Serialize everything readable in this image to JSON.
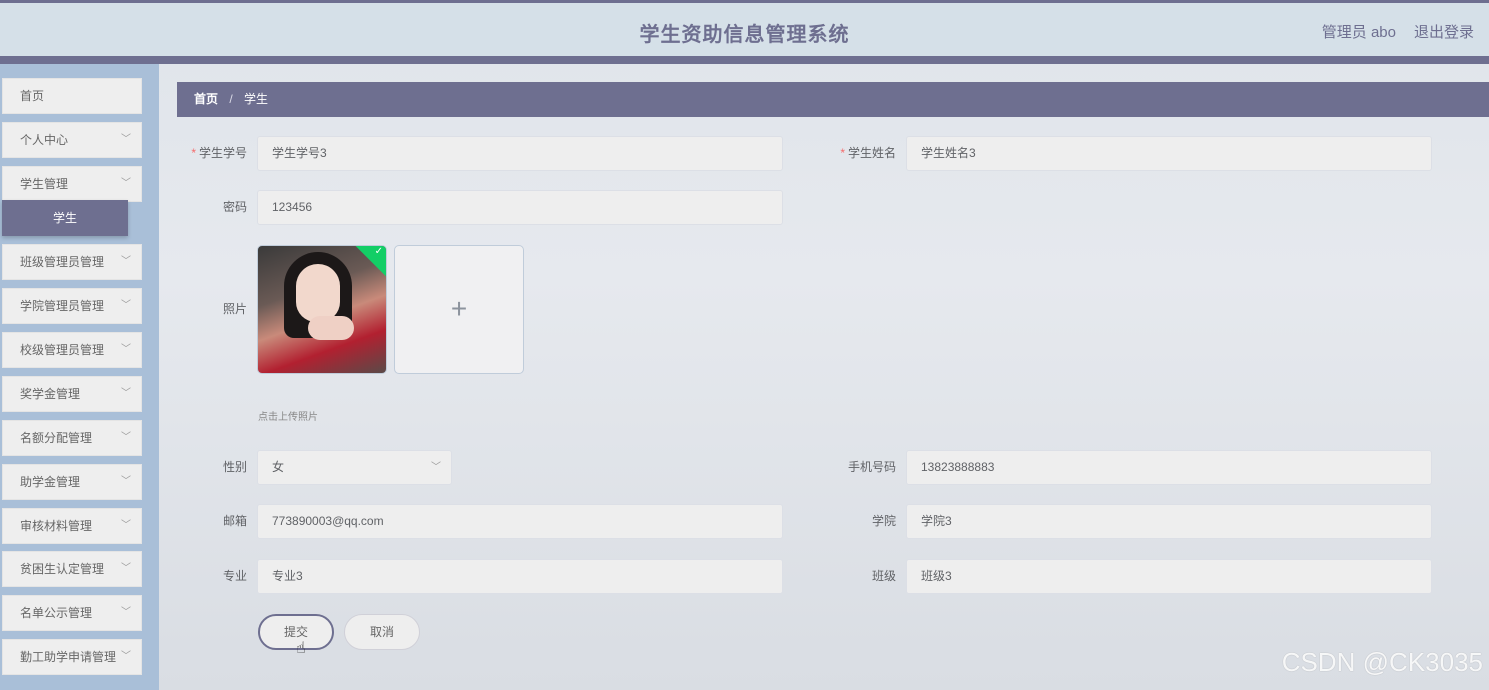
{
  "header": {
    "title": "学生资助信息管理系统",
    "user": "管理员 abo",
    "logout": "退出登录"
  },
  "sidebar": {
    "items": [
      {
        "label": "首页",
        "has_chevron": false
      },
      {
        "label": "个人中心",
        "has_chevron": true
      },
      {
        "label": "学生管理",
        "has_chevron": true
      },
      {
        "label": "班级管理员管理",
        "has_chevron": true
      },
      {
        "label": "学院管理员管理",
        "has_chevron": true
      },
      {
        "label": "校级管理员管理",
        "has_chevron": true
      },
      {
        "label": "奖学金管理",
        "has_chevron": true
      },
      {
        "label": "名额分配管理",
        "has_chevron": true
      },
      {
        "label": "助学金管理",
        "has_chevron": true
      },
      {
        "label": "审核材料管理",
        "has_chevron": true
      },
      {
        "label": "贫困生认定管理",
        "has_chevron": true
      },
      {
        "label": "名单公示管理",
        "has_chevron": true
      },
      {
        "label": "勤工助学申请管理",
        "has_chevron": true
      }
    ],
    "active_sub": "学生"
  },
  "breadcrumb": {
    "home": "首页",
    "separator": "/",
    "current": "学生"
  },
  "form": {
    "student_no": {
      "label": "学生学号",
      "value": "学生学号3",
      "required": true
    },
    "student_name": {
      "label": "学生姓名",
      "value": "学生姓名3",
      "required": true
    },
    "password": {
      "label": "密码",
      "value": "123456"
    },
    "photo": {
      "label": "照片",
      "upload_hint": "点击上传照片",
      "add_icon": "+"
    },
    "gender": {
      "label": "性别",
      "value": "女"
    },
    "phone": {
      "label": "手机号码",
      "value": "13823888883"
    },
    "email": {
      "label": "邮箱",
      "value": "773890003@qq.com"
    },
    "college": {
      "label": "学院",
      "value": "学院3"
    },
    "major": {
      "label": "专业",
      "value": "专业3"
    },
    "class": {
      "label": "班级",
      "value": "班级3"
    },
    "submit": "提交",
    "cancel": "取消"
  },
  "watermark": "CSDN @CK3035",
  "colors": {
    "accent": "#6e6f90",
    "sidebar": "#a9bfd8",
    "header": "#d5e0e8",
    "required": "#f56c6c",
    "success": "#13ce66"
  }
}
